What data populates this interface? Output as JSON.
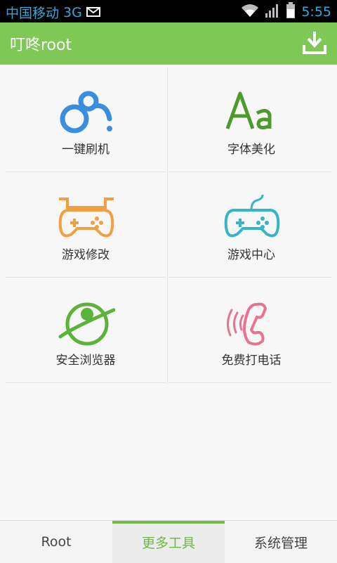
{
  "status_bar": {
    "carrier": "中国移动",
    "network": "3G",
    "time": "5:55",
    "icons": [
      "mail-icon",
      "wifi-icon",
      "signal-icon",
      "battery-icon"
    ]
  },
  "header": {
    "title": "叮咚root",
    "download_icon": "download-icon"
  },
  "tools": [
    {
      "label": "一键刷机",
      "icon": "brush-flash-icon",
      "color": "#3a8ee0"
    },
    {
      "label": "字体美化",
      "icon": "font-aa-icon",
      "color": "#4e9a2b"
    },
    {
      "label": "游戏修改",
      "icon": "gamepad-mod-icon",
      "color": "#f0a040"
    },
    {
      "label": "游戏中心",
      "icon": "gamepad-icon",
      "color": "#38b4c8"
    },
    {
      "label": "安全浏览器",
      "icon": "planet-browser-icon",
      "color": "#5bb33a"
    },
    {
      "label": "免费打电话",
      "icon": "phone-call-icon",
      "color": "#e8738e"
    }
  ],
  "bottom_nav": {
    "tabs": [
      "Root",
      "更多工具",
      "系统管理"
    ],
    "active_index": 1,
    "active_color": "#6dbb43"
  }
}
